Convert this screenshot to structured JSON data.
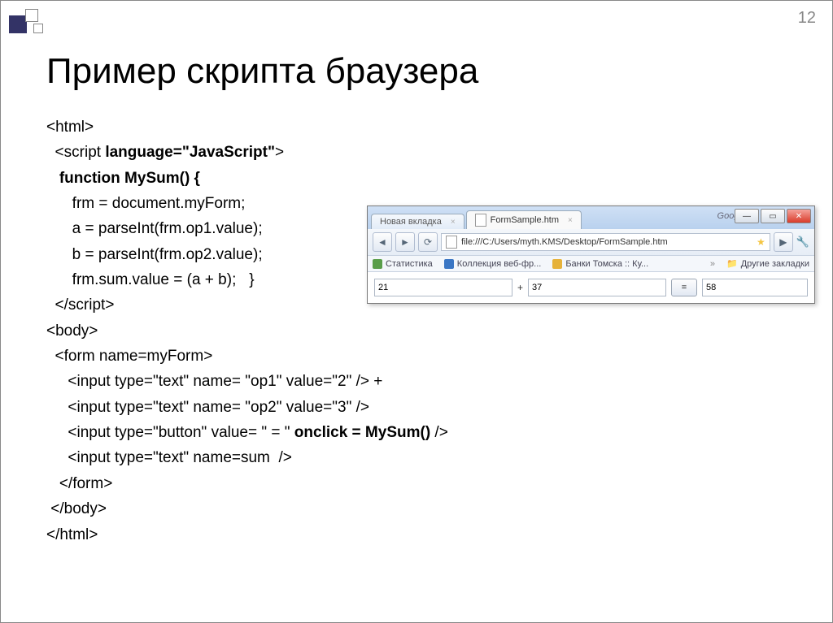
{
  "slide": {
    "page_number": "12",
    "title": "Пример скрипта браузера"
  },
  "code_lines": [
    "<html>",
    "  <script language=\"JavaScript\">",
    "   function MySum() {",
    "      frm = document.myForm;",
    "      a = parseInt(frm.op1.value);",
    "      b = parseInt(frm.op2.value);",
    "      frm.sum.value = (a + b);   }",
    "  </script>",
    "",
    "<body>",
    "  <form name=myForm>",
    "     <input type=\"text\" name= \"op1\" value=\"2\" /> +",
    "     <input type=\"text\" name= \"op2\" value=\"3\" />",
    "     <input type=\"button\" value= \" = \" onclick = MySum() />",
    "     <input type=\"text\" name=sum  />",
    "   </form>",
    " </body>",
    "</html>"
  ],
  "code_bold": {
    "1": "language=\"JavaScript\"",
    "2": "function MySum() {",
    "13": "onclick = MySum()"
  },
  "browser": {
    "search_engine": "Google",
    "tabs": [
      {
        "label": "Новая вкладка",
        "active": false
      },
      {
        "label": "FormSample.htm",
        "active": true
      }
    ],
    "url": "file:///C:/Users/myth.KMS/Desktop/FormSample.htm",
    "bookmarks": [
      {
        "label": "Статистика",
        "color": "#5a9e4a"
      },
      {
        "label": "Коллекция веб-фр...",
        "color": "#3a76c4"
      },
      {
        "label": "Банки Томска :: Ку...",
        "color": "#e6b23a"
      }
    ],
    "other_bookmarks": "Другие закладки",
    "form": {
      "op1": "21",
      "plus": "+",
      "op2": "37",
      "eq": "=",
      "sum": "58"
    },
    "win_buttons": {
      "min": "—",
      "max": "▭",
      "close": "✕"
    }
  }
}
